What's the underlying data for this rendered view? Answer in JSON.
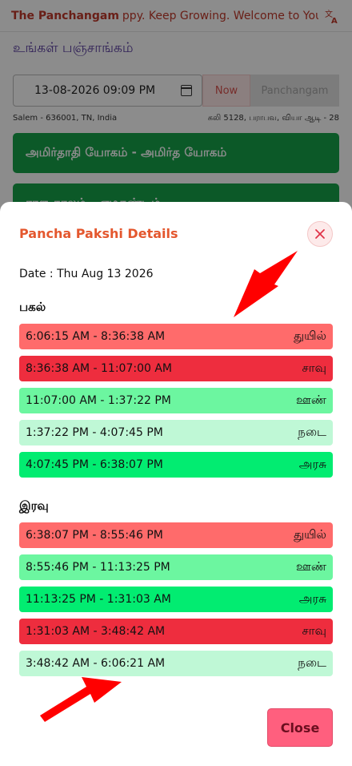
{
  "header": {
    "brand": "The Panchangam",
    "marquee": "ppy. Keep Growing.   Welcome to Your",
    "translate_icon": "translate-icon"
  },
  "page": {
    "title": "உங்கள் பஞ்சாங்கம்"
  },
  "datetime": {
    "value": "13-08-2026  09:09  PM",
    "now_label": "Now",
    "panchangam_label": "Panchangam"
  },
  "location": {
    "place": "Salem - 636001, TN, India",
    "era": "கலி 5128, பராபவ, வியா ஆடி - 28"
  },
  "yoga": {
    "title": "அமிர்தாதி யோகம் - அமிர்த யோகம்",
    "second": "ராகு காலம் - எமகண்டம்"
  },
  "modal": {
    "title": "Pancha Pakshi Details",
    "date": "Date : Thu Aug 13 2026",
    "day_label": "பகல்",
    "night_label": "இரவு",
    "close_label": "Close",
    "day_slots": [
      {
        "time": "6:06:15 AM - 8:36:38 AM",
        "state": "துயில்",
        "color": "#ff6b6b"
      },
      {
        "time": "8:36:38 AM - 11:07:00 AM",
        "state": "சாவு",
        "color": "#ee2d3e"
      },
      {
        "time": "11:07:00 AM - 1:37:22 PM",
        "state": "ஊண்",
        "color": "#6cf6a0"
      },
      {
        "time": "1:37:22 PM - 4:07:45 PM",
        "state": "நடை",
        "color": "#bff8d6"
      },
      {
        "time": "4:07:45 PM - 6:38:07 PM",
        "state": "அரசு",
        "color": "#02ec71"
      }
    ],
    "night_slots": [
      {
        "time": "6:38:07 PM - 8:55:46 PM",
        "state": "துயில்",
        "color": "#ff6b6b"
      },
      {
        "time": "8:55:46 PM - 11:13:25 PM",
        "state": "ஊண்",
        "color": "#6cf6a0"
      },
      {
        "time": "11:13:25 PM - 1:31:03 AM",
        "state": "அரசு",
        "color": "#02ec71"
      },
      {
        "time": "1:31:03 AM - 3:48:42 AM",
        "state": "சாவு",
        "color": "#ee2d3e"
      },
      {
        "time": "3:48:42 AM - 6:06:21 AM",
        "state": "நடை",
        "color": "#bff8d6"
      }
    ]
  },
  "annotation": {
    "arrow_color": "#ff0000"
  }
}
